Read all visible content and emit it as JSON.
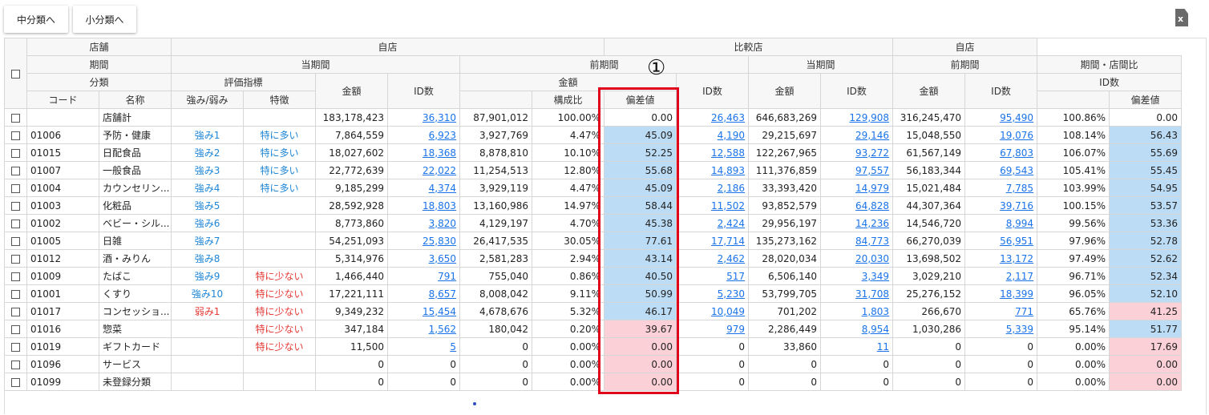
{
  "buttons": {
    "mid": "中分類へ",
    "small": "小分類へ"
  },
  "export_icon": "excel-export-icon",
  "export_icon_text": "x",
  "annotation_marker": "①",
  "colors": {
    "high": "#bcdcf5",
    "low": "#fbd0d6",
    "highlight_border": "#e0001b",
    "link": "#1a73e8"
  },
  "header": {
    "row1": {
      "store": "店舗",
      "own": "自店",
      "compare": "比較店",
      "own2": "自店"
    },
    "row2": {
      "period": "期間",
      "current": "当期間",
      "previous": "前期間",
      "c_current": "当期間",
      "c_previous": "前期間",
      "period_ratio": "期間・店間比"
    },
    "row3": {
      "category": "分類",
      "eval": "評価指標",
      "amount": "金額",
      "id_count": "ID数",
      "prev_amount": "金額",
      "prev_id": "ID数",
      "c_amount": "金額",
      "c_id": "ID数",
      "cp_amount": "金額",
      "cp_id": "ID数",
      "ratio_id": "ID数"
    },
    "row4": {
      "code": "コード",
      "name": "名称",
      "strength": "強み/弱み",
      "feature": "特徴",
      "composition": "構成比",
      "deviation": "偏差値",
      "ratio_dev": "偏差値"
    }
  },
  "rows": [
    {
      "code": "",
      "name": "店舗計",
      "strength": "",
      "stype": "",
      "feature": "",
      "ftype": "",
      "amount": "183,178,423",
      "id": "36,310",
      "prev_amount": "87,901,012",
      "comp": "100.00%",
      "dev": "0.00",
      "dev_c": "",
      "prev_id": "26,463",
      "c_amount": "646,683,269",
      "c_id": "129,908",
      "cp_amount": "316,245,470",
      "cp_id": "95,490",
      "ratio": "100.86%",
      "ratio_dev": "0.00",
      "rdev_c": ""
    },
    {
      "code": "01006",
      "name": "予防・健康",
      "strength": "強み1",
      "stype": "strong",
      "feature": "特に多い",
      "ftype": "many",
      "amount": "7,864,559",
      "id": "6,923",
      "prev_amount": "3,927,769",
      "comp": "4.47%",
      "dev": "45.09",
      "dev_c": "blue",
      "prev_id": "4,190",
      "c_amount": "29,215,697",
      "c_id": "29,146",
      "cp_amount": "15,048,550",
      "cp_id": "19,076",
      "ratio": "108.14%",
      "ratio_dev": "56.43",
      "rdev_c": "blue"
    },
    {
      "code": "01015",
      "name": "日配食品",
      "strength": "強み2",
      "stype": "strong",
      "feature": "特に多い",
      "ftype": "many",
      "amount": "18,027,602",
      "id": "18,368",
      "prev_amount": "8,878,810",
      "comp": "10.10%",
      "dev": "52.25",
      "dev_c": "blue",
      "prev_id": "12,588",
      "c_amount": "122,267,965",
      "c_id": "93,272",
      "cp_amount": "61,567,149",
      "cp_id": "67,803",
      "ratio": "106.07%",
      "ratio_dev": "55.69",
      "rdev_c": "blue"
    },
    {
      "code": "01007",
      "name": "一般食品",
      "strength": "強み3",
      "stype": "strong",
      "feature": "特に多い",
      "ftype": "many",
      "amount": "22,772,639",
      "id": "22,022",
      "prev_amount": "11,254,513",
      "comp": "12.80%",
      "dev": "55.68",
      "dev_c": "blue",
      "prev_id": "14,893",
      "c_amount": "111,376,859",
      "c_id": "97,557",
      "cp_amount": "56,183,344",
      "cp_id": "69,543",
      "ratio": "105.41%",
      "ratio_dev": "55.45",
      "rdev_c": "blue"
    },
    {
      "code": "01004",
      "name": "カウンセリン...",
      "strength": "強み4",
      "stype": "strong",
      "feature": "特に多い",
      "ftype": "many",
      "amount": "9,185,299",
      "id": "4,374",
      "prev_amount": "3,929,119",
      "comp": "4.47%",
      "dev": "45.09",
      "dev_c": "blue",
      "prev_id": "2,186",
      "c_amount": "33,393,420",
      "c_id": "14,979",
      "cp_amount": "15,021,484",
      "cp_id": "7,785",
      "ratio": "103.99%",
      "ratio_dev": "54.95",
      "rdev_c": "blue"
    },
    {
      "code": "01003",
      "name": "化粧品",
      "strength": "強み5",
      "stype": "strong",
      "feature": "",
      "ftype": "",
      "amount": "28,592,928",
      "id": "18,803",
      "prev_amount": "13,160,986",
      "comp": "14.97%",
      "dev": "58.44",
      "dev_c": "blue",
      "prev_id": "11,502",
      "c_amount": "93,852,579",
      "c_id": "64,828",
      "cp_amount": "44,307,364",
      "cp_id": "39,716",
      "ratio": "100.15%",
      "ratio_dev": "53.57",
      "rdev_c": "blue"
    },
    {
      "code": "01002",
      "name": "ベビー・シル...",
      "strength": "強み6",
      "stype": "strong",
      "feature": "",
      "ftype": "",
      "amount": "8,773,860",
      "id": "3,820",
      "prev_amount": "4,129,197",
      "comp": "4.70%",
      "dev": "45.38",
      "dev_c": "blue",
      "prev_id": "2,424",
      "c_amount": "29,956,197",
      "c_id": "14,236",
      "cp_amount": "14,546,720",
      "cp_id": "8,994",
      "ratio": "99.56%",
      "ratio_dev": "53.36",
      "rdev_c": "blue"
    },
    {
      "code": "01005",
      "name": "日雑",
      "strength": "強み7",
      "stype": "strong",
      "feature": "",
      "ftype": "",
      "amount": "54,251,093",
      "id": "25,830",
      "prev_amount": "26,417,535",
      "comp": "30.05%",
      "dev": "77.61",
      "dev_c": "blue",
      "prev_id": "17,714",
      "c_amount": "135,273,162",
      "c_id": "84,773",
      "cp_amount": "66,270,039",
      "cp_id": "56,951",
      "ratio": "97.96%",
      "ratio_dev": "52.78",
      "rdev_c": "blue"
    },
    {
      "code": "01012",
      "name": "酒・みりん",
      "strength": "強み8",
      "stype": "strong",
      "feature": "",
      "ftype": "",
      "amount": "5,314,976",
      "id": "3,650",
      "prev_amount": "2,581,283",
      "comp": "2.94%",
      "dev": "43.14",
      "dev_c": "blue",
      "prev_id": "2,462",
      "c_amount": "28,020,034",
      "c_id": "20,030",
      "cp_amount": "13,698,502",
      "cp_id": "13,172",
      "ratio": "97.49%",
      "ratio_dev": "52.62",
      "rdev_c": "blue"
    },
    {
      "code": "01009",
      "name": "たばこ",
      "strength": "強み9",
      "stype": "strong",
      "feature": "特に少ない",
      "ftype": "few",
      "amount": "1,466,440",
      "id": "791",
      "prev_amount": "755,040",
      "comp": "0.86%",
      "dev": "40.50",
      "dev_c": "blue",
      "prev_id": "517",
      "c_amount": "6,506,140",
      "c_id": "3,349",
      "cp_amount": "3,029,210",
      "cp_id": "2,117",
      "ratio": "96.71%",
      "ratio_dev": "52.34",
      "rdev_c": "blue"
    },
    {
      "code": "01001",
      "name": "くすり",
      "strength": "強み10",
      "stype": "strong",
      "feature": "特に少ない",
      "ftype": "few",
      "amount": "17,221,111",
      "id": "8,657",
      "prev_amount": "8,008,042",
      "comp": "9.11%",
      "dev": "50.99",
      "dev_c": "blue",
      "prev_id": "5,230",
      "c_amount": "53,799,705",
      "c_id": "31,708",
      "cp_amount": "25,276,152",
      "cp_id": "18,399",
      "ratio": "96.05%",
      "ratio_dev": "52.10",
      "rdev_c": "blue"
    },
    {
      "code": "01017",
      "name": "コンセッショ...",
      "strength": "弱み1",
      "stype": "weak",
      "feature": "特に少ない",
      "ftype": "few",
      "amount": "9,349,232",
      "id": "15,454",
      "prev_amount": "4,678,676",
      "comp": "5.32%",
      "dev": "46.17",
      "dev_c": "blue",
      "prev_id": "10,049",
      "c_amount": "701,202",
      "c_id": "1,803",
      "cp_amount": "266,670",
      "cp_id": "771",
      "ratio": "65.76%",
      "ratio_dev": "41.25",
      "rdev_c": "pink"
    },
    {
      "code": "01016",
      "name": "惣菜",
      "strength": "",
      "stype": "",
      "feature": "特に少ない",
      "ftype": "few",
      "amount": "347,184",
      "id": "1,562",
      "prev_amount": "180,042",
      "comp": "0.20%",
      "dev": "39.67",
      "dev_c": "pink",
      "prev_id": "979",
      "c_amount": "2,286,449",
      "c_id": "8,954",
      "cp_amount": "1,030,286",
      "cp_id": "5,339",
      "ratio": "95.14%",
      "ratio_dev": "51.77",
      "rdev_c": "blue"
    },
    {
      "code": "01019",
      "name": "ギフトカード",
      "strength": "",
      "stype": "",
      "feature": "特に少ない",
      "ftype": "few",
      "amount": "11,500",
      "id": "5",
      "prev_amount": "0",
      "comp": "0.00%",
      "dev": "0.00",
      "dev_c": "pink",
      "prev_id": "0",
      "c_amount": "33,860",
      "c_id": "11",
      "cp_amount": "0",
      "cp_id": "0",
      "ratio": "0.00%",
      "ratio_dev": "17.69",
      "rdev_c": "pink"
    },
    {
      "code": "01096",
      "name": "サービス",
      "strength": "",
      "stype": "",
      "feature": "",
      "ftype": "",
      "amount": "0",
      "id": "0",
      "prev_amount": "0",
      "comp": "0.00%",
      "dev": "0.00",
      "dev_c": "pink",
      "prev_id": "0",
      "c_amount": "0",
      "c_id": "0",
      "cp_amount": "0",
      "cp_id": "0",
      "ratio": "0.00%",
      "ratio_dev": "0.00",
      "rdev_c": "pink"
    },
    {
      "code": "01099",
      "name": "未登録分類",
      "strength": "",
      "stype": "",
      "feature": "",
      "ftype": "",
      "amount": "0",
      "id": "0",
      "prev_amount": "0",
      "comp": "0.00%",
      "dev": "0.00",
      "dev_c": "pink",
      "prev_id": "0",
      "c_amount": "0",
      "c_id": "0",
      "cp_amount": "0",
      "cp_id": "0",
      "ratio": "0.00%",
      "ratio_dev": "0.00",
      "rdev_c": "pink"
    }
  ]
}
